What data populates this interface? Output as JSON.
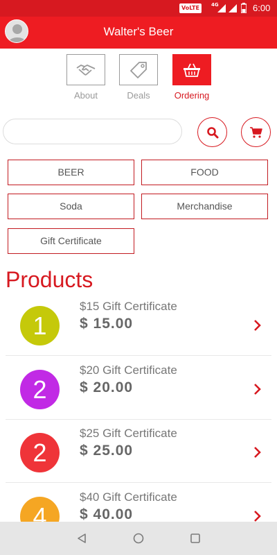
{
  "status_bar": {
    "network_badge": "VoLTE",
    "network_type": "4G",
    "time": "6:00"
  },
  "app_bar": {
    "title": "Walter's Beer"
  },
  "tabs": [
    {
      "label": "About",
      "icon": "handshake-icon",
      "active": false
    },
    {
      "label": "Deals",
      "icon": "tag-icon",
      "active": false
    },
    {
      "label": "Ordering",
      "icon": "basket-icon",
      "active": true
    }
  ],
  "search": {
    "placeholder": ""
  },
  "categories": [
    "BEER",
    "FOOD",
    "Soda",
    "Merchandise",
    "Gift Certificate"
  ],
  "products_heading": "Products",
  "products": [
    {
      "badge": "1",
      "name": "$15 Gift Certificate",
      "price": "$ 15.00",
      "color": "#c5c90a"
    },
    {
      "badge": "2",
      "name": "$20 Gift Certificate",
      "price": "$ 20.00",
      "color": "#c12ae5"
    },
    {
      "badge": "2",
      "name": "$25 Gift Certificate",
      "price": "$ 25.00",
      "color": "#ef3439"
    },
    {
      "badge": "4",
      "name": "$40 Gift Certificate",
      "price": "$ 40.00",
      "color": "#f5a623"
    }
  ],
  "colors": {
    "accent": "#ee1c22",
    "status": "#d71920",
    "nav": "#e6e6e6"
  }
}
